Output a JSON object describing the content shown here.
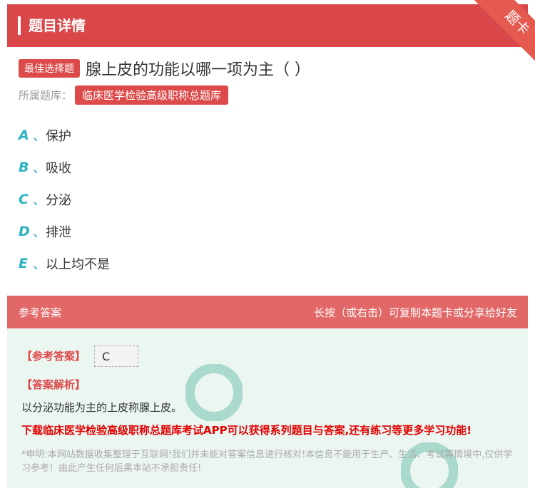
{
  "header": {
    "title": "题目详情",
    "corner_badge": "题卡"
  },
  "question": {
    "type_tag": "最佳选择题",
    "text": "腺上皮的功能以哪一项为主（ ）",
    "bank_label": "所属题库：",
    "bank_name": "临床医学检验高级职称总题库"
  },
  "options": [
    {
      "letter": "A",
      "sep": "、",
      "text": "保护"
    },
    {
      "letter": "B",
      "sep": "、",
      "text": "吸收"
    },
    {
      "letter": "C",
      "sep": "、",
      "text": "分泌"
    },
    {
      "letter": "D",
      "sep": "、",
      "text": "排泄"
    },
    {
      "letter": "E",
      "sep": "、",
      "text": "以上均不是"
    }
  ],
  "answer_section": {
    "header_left": "参考答案",
    "header_right": "长按（或右击）可复制本题卡或分享给好友",
    "answer_title": "【参考答案】",
    "answer_value": "C",
    "explain_title": "【答案解析】",
    "explanation": "以分泌功能为主的上皮称腺上皮。",
    "promo": "下载临床医学检验高级职称总题库考试APP可以获得系列题目与答案,还有练习等更多学习功能!",
    "disclaimer": "*申明:本网站数据收集整理于互联网!我们并未能对答案信息进行核对!本信息不能用于生产、生活、考试等情境中,仅供学习参考！由此产生任何后果本站不承担责任!"
  },
  "colors": {
    "primary_red": "#d9474a",
    "option_teal": "#2bb2c0",
    "answer_bg": "#ecf6f1"
  }
}
